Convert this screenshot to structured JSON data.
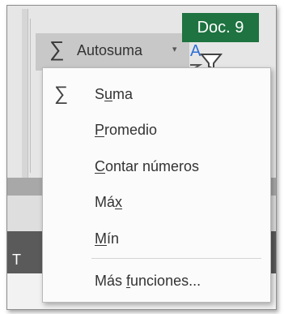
{
  "ribbon": {
    "autosum_icon": "sigma-icon",
    "autosum_label": "Autosuma",
    "autosum_arrow": "▾",
    "partial_text_right": "y",
    "partial_text_left": "T"
  },
  "badge": {
    "label": "Doc. 9",
    "color": "#1e7340"
  },
  "menu": {
    "items": [
      {
        "icon": "sigma-icon",
        "pre": "S",
        "key": "u",
        "post": "ma"
      },
      {
        "pre": "",
        "key": "P",
        "post": "romedio"
      },
      {
        "pre": "",
        "key": "C",
        "post": "ontar números"
      },
      {
        "pre": "Má",
        "key": "x",
        "post": ""
      },
      {
        "pre": "",
        "key": "M",
        "post": "ín"
      },
      {
        "pre": "Más ",
        "key": "f",
        "post": "unciones..."
      }
    ]
  }
}
